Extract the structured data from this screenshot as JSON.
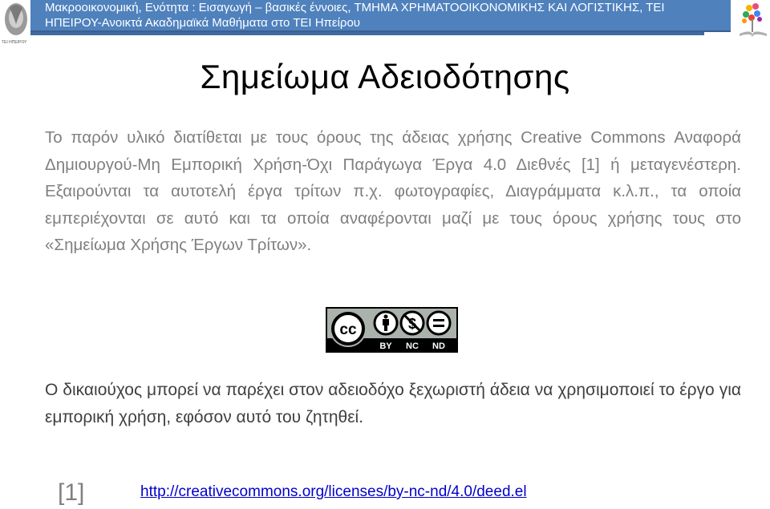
{
  "header": {
    "title_line1": "Μακροοικονομική, Ενότητα : Εισαγωγή – βασικές έννοιες, ΤΜΗΜΑ ΧΡΗΜΑΤΟΟΙΚΟΝΟΜΙΚΗΣ ΚΑΙ ΛΟΓΙΣΤΙΚΗΣ, ΤΕΙ",
    "title_line2": "ΗΠΕΙΡΟΥ-Ανοικτά Ακαδημαϊκά  Μαθήματα στο ΤΕΙ Ηπείρου",
    "left_logo_caption": "ΤΕΙ ΗΠΕΙΡΟΥ",
    "bar_color": "#4f81bd"
  },
  "page": {
    "title": "Σημείωμα Αδειοδότησης",
    "paragraph1": "Το παρόν υλικό διατίθεται με τους όρους της άδειας χρήσης Creative Commons Αναφορά Δημιουργού-Μη Εμπορική Χρήση-Όχι Παράγωγα Έργα 4.0 Διεθνές [1] ή μεταγενέστερη. Εξαιρούνται τα αυτοτελή έργα τρίτων π.χ. φωτογραφίες, Διαγράμματα κ.λ.π., τα οποία εμπεριέχονται σε αυτό και τα οποία αναφέρονται μαζί με τους όρους χρήσης τους στο «Σημείωμα Χρήσης Έργων Τρίτων».",
    "paragraph2": "Ο δικαιούχος μπορεί να παρέχει στον αδειοδόχο ξεχωριστή άδεια να χρησιμοποιεί το έργο για εμπορική χρήση, εφόσον αυτό του ζητηθεί."
  },
  "license_badge": {
    "cc": "cc",
    "labels": [
      "BY",
      "NC",
      "ND"
    ]
  },
  "reference": {
    "number": "[1]",
    "url": "http://creativecommons.org/licenses/by-nc-nd/4.0/deed.el"
  }
}
